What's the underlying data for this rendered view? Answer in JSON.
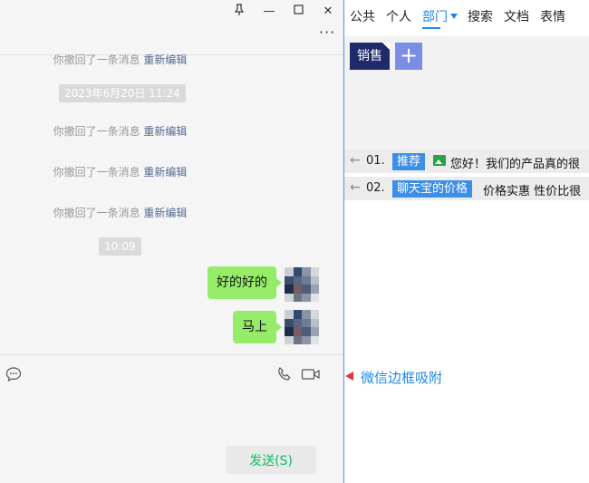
{
  "chat": {
    "window_controls": {
      "pin": "⊥",
      "minimize": "—",
      "maximize": "☐",
      "close": "✕"
    },
    "more_label": "···",
    "system_messages": [
      {
        "text": "你撤回了一条消息",
        "link": "重新编辑"
      },
      {
        "text": "你撤回了一条消息",
        "link": "重新编辑"
      },
      {
        "text": "你撤回了一条消息",
        "link": "重新编辑"
      },
      {
        "text": "你撤回了一条消息",
        "link": "重新编辑"
      }
    ],
    "timestamps": [
      "2023年6月20日 11:24",
      "10:09"
    ],
    "messages": [
      {
        "text": "好的好的"
      },
      {
        "text": "马上"
      }
    ],
    "send_label": "发送(S)",
    "icons": {
      "emoji": "emoji-icon",
      "phone": "phone-icon",
      "video": "video-icon"
    }
  },
  "panel": {
    "tabs": [
      "公共",
      "个人",
      "部门",
      "搜索",
      "文档",
      "表情"
    ],
    "active_tab": "部门",
    "category_button": "销售",
    "add_label": "+",
    "rows": [
      {
        "num": "01.",
        "tag": "推荐",
        "text": "您好！我们的产品真的很"
      },
      {
        "num": "02.",
        "tag": "聊天宝的价格",
        "text": "价格实惠 性价比很"
      }
    ]
  },
  "annotation": {
    "text": "微信边框吸附"
  },
  "colors": {
    "accent": "#1e88e5",
    "bubble": "#95ec69",
    "send_text": "#07c160",
    "link": "#576b95"
  }
}
